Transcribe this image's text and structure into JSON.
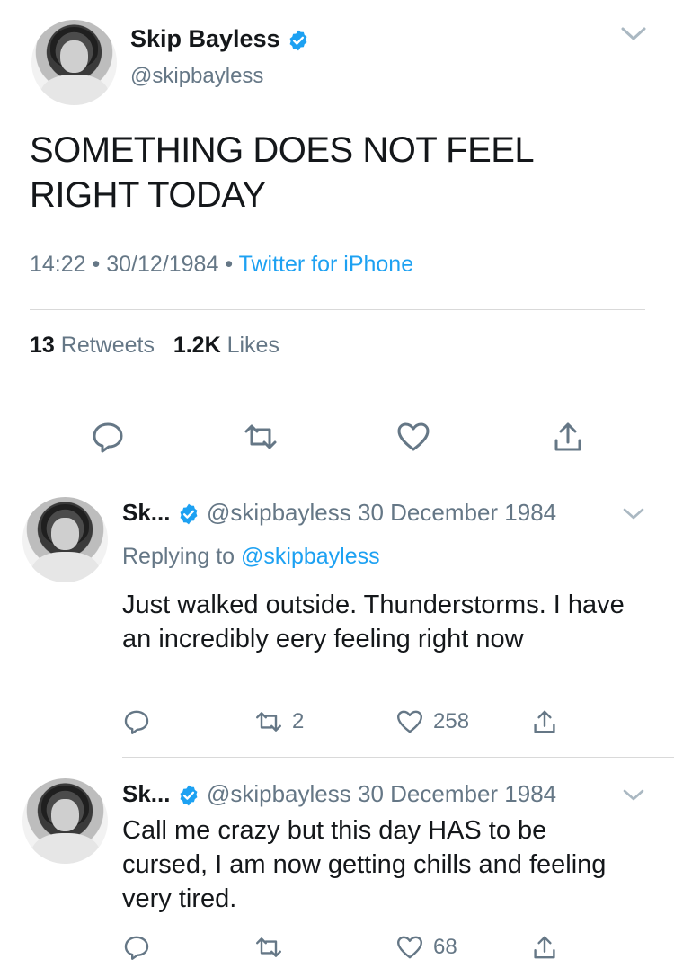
{
  "main_tweet": {
    "display_name": "Skip Bayless",
    "handle": "@skipbayless",
    "text": "SOMETHING DOES NOT FEEL RIGHT TODAY",
    "time": "14:22",
    "date": "30/12/1984",
    "separator": "•",
    "source": "Twitter for iPhone",
    "retweets_count": "13",
    "retweets_label": "Retweets",
    "likes_count": "1.2K",
    "likes_label": "Likes",
    "avatar_signature": "Skip Bayless"
  },
  "replies": [
    {
      "display_name": "Sk...",
      "handle": "@skipbayless",
      "date": "30 December 1984",
      "replying_label": "Replying to",
      "replying_to": "@skipbayless",
      "text": "Just walked outside. Thunderstorms. I have an incredibly eery feeling right now",
      "retweets": "2",
      "likes": "258"
    },
    {
      "display_name": "Sk...",
      "handle": "@skipbayless",
      "date": "30 December 1984",
      "text": "Call me crazy but this day HAS to be cursed, I am now getting chills and feeling very tired.",
      "retweets": "",
      "likes": "68"
    }
  ],
  "colors": {
    "accent": "#1da1f2",
    "secondary_text": "#657786",
    "primary_text": "#14171a",
    "divider": "#d9d9d9"
  },
  "icons": [
    "verified-badge-icon",
    "chevron-down-icon",
    "reply-icon",
    "retweet-icon",
    "like-icon",
    "share-icon"
  ]
}
